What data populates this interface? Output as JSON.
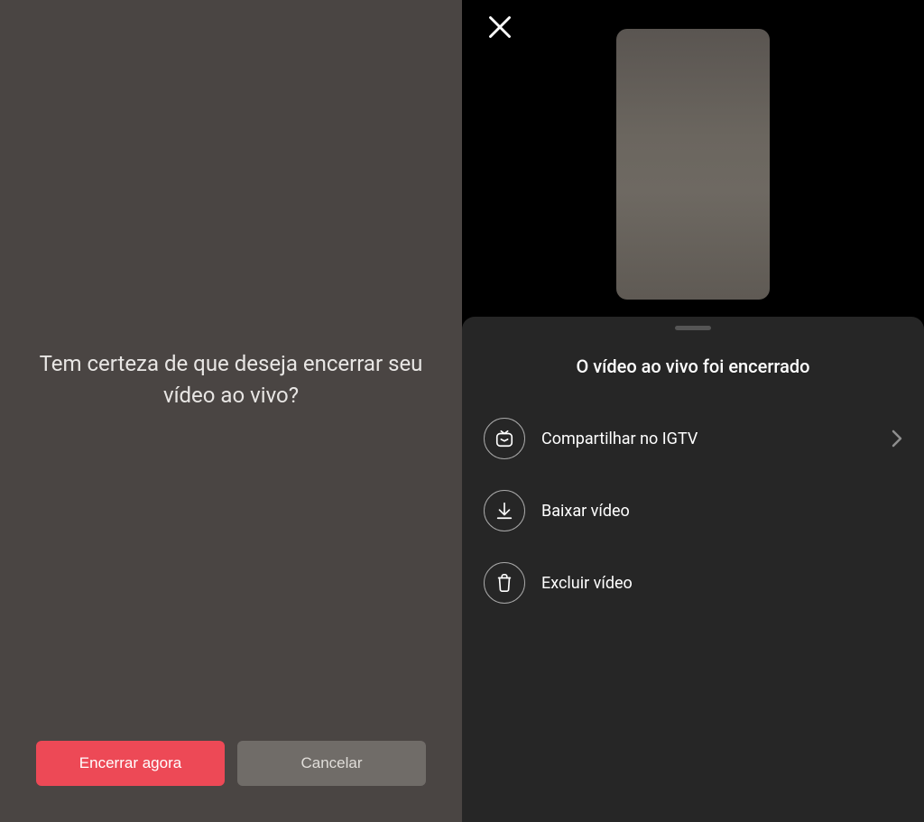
{
  "left": {
    "message": "Tem certeza de que deseja encerrar seu vídeo ao vivo?",
    "buttons": {
      "end_now": "Encerrar agora",
      "cancel": "Cancelar"
    }
  },
  "right": {
    "sheet_title": "O vídeo ao vivo foi encerrado",
    "options": {
      "share_igtv": "Compartilhar no IGTV",
      "download": "Baixar vídeo",
      "delete": "Excluir vídeo"
    }
  },
  "colors": {
    "primary": "#ed4956",
    "sheet_bg": "#262626"
  }
}
